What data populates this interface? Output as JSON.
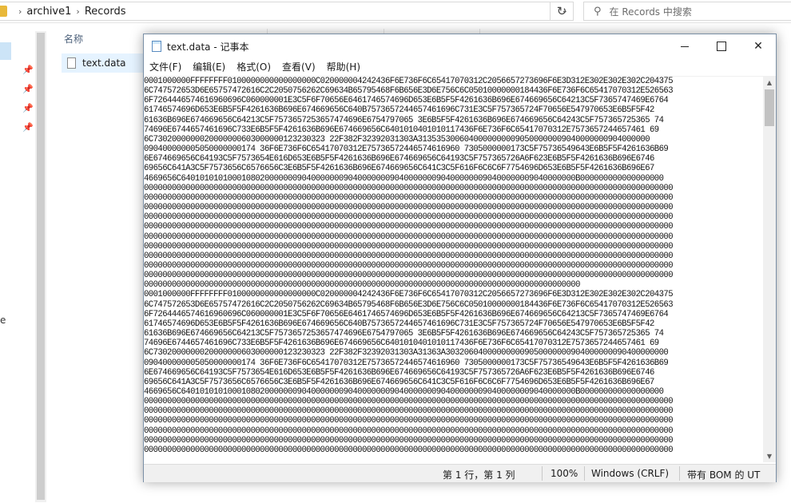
{
  "explorer": {
    "breadcrumbs": [
      "archive1",
      "Records"
    ],
    "search_placeholder": "在 Records 中搜索",
    "column_name": "名称",
    "files": [
      {
        "name": "text.data"
      }
    ],
    "nav_fragment": "e"
  },
  "notepad": {
    "title": "text.data - 记事本",
    "menu": [
      "文件(F)",
      "编辑(E)",
      "格式(O)",
      "查看(V)",
      "帮助(H)"
    ],
    "content_lines": [
      "0001000000FFFFFFFF0100000000000000000C020000004242436F6E736F6C65417070312C2056657273696F6E3D312E302E302E302C204375",
      "6C747572653D6E65757472616C2C2050756262C69634B65795468F6B656E3D6E756C6C05010000000184436F6E736F6C65417070312E526563",
      "6F7264446574616960696C060000001E3C5F6F70656E6461746574696D653E6B5F5F4261636B696E674669656C64213C5F7365747469E6764",
      "61746574696D653E6B5F5F4261636B696E674669656C640B7573657244657461696C731E3C5F757365724F70656E547970653E6B5F5F42",
      "61636B696E674669656C64213C5F7573657253657474696E6754797065 3E6B5F5F4261636B696E674669656C64243C5F757365725365 74",
      "74696E6744657461696C733E6B5F5F4261636B696E674669656C6401010401010117436F6E736F6C65417070312E7573657244657461 69",
      "6C7302000000020000000603000000123230323 22F382F32392031303A31353530060400000000090500000009040000000904000000",
      "090400000005050000000174 36F6E736F6C65417070312E75736572446574616960 7305000000173C5F75736549643E6B5F5F4261636B69",
      "6E674669656C64193C5F7573654E616D653E6B5F5F4261636B696E674669656C64193C5F757365726A6F623E6B5F5F4261636B696E6746",
      "69656C641A3C5F7573656C6576656C3E6B5F5F4261636B696E674669656C641C3C5F616F6C6C6F7754696D653E6B5F5F4261636B696E67",
      "4669656C6401010101000108020000000904000000090400000009040000000904000000090400000009040000000B000000000000000000",
      "000000000000000000000000000000000000000000000000000000000000000000000000000000000000000000000000000000000000000000",
      "000000000000000000000000000000000000000000000000000000000000000000000000000000000000000000000000000000000000000000",
      "000000000000000000000000000000000000000000000000000000000000000000000000000000000000000000000000000000000000000000",
      "000000000000000000000000000000000000000000000000000000000000000000000000000000000000000000000000000000000000000000",
      "000000000000000000000000000000000000000000000000000000000000000000000000000000000000000000000000000000000000000000",
      "000000000000000000000000000000000000000000000000000000000000000000000000000000000000000000000000000000000000000000",
      "000000000000000000000000000000000000000000000000000000000000000000000000000000000000000000000000000000000000000000",
      "000000000000000000000000000000000000000000000000000000000000000000000000000000000000000000000000000000000000000000",
      "000000000000000000000000000000000000000000000000000000000000000000000000000000000000000000000000000000000000000000",
      "000000000000000000000000000000000000000000000000000000000000000000000000000000000000000000000000000000000000000000",
      "0000000000000000000000000000000000000000000000000000000000000000000000000000000000000000000000",
      "0001000000FFFFFFFF0100000000000000000C020000004242436F6E736F6C65417070312C2056657273696F6E3D312E302E302E302C204375",
      "6C747572653D6E65757472616C2C2050756262C69634B65795468F6B656E3D6E756C6C05010000000184436F6E736F6C65417070312E526563",
      "6F7264446574616960696C060000001E3C5F6F70656E6461746574696D653E6B5F5F4261636B696E674669656C64213C5F7365747469E6764",
      "61746574696D653E6B5F5F4261636B696E674669656C640B7573657244657461696C731E3C5F757365724F70656E547970653E6B5F5F42",
      "61636B696E674669656C64213C5F7573657253657474696E6754797065 3E6B5F5F4261636B696E674669656C64243C5F757365725365 74",
      "74696E6744657461696C733E6B5F5F4261636B696E674669656C6401010401010117436F6E736F6C65417070312E7573657244657461 69",
      "6C7302000000020000000603000000123230323 22F382F32392031303A31363A303206040000000009050000000904000000090400000000",
      "090400000005050000000174 36F6E736F6C65417070312E75736572446574616960 7305000000173C5F75736549643E6B5F5F4261636B69",
      "6E674669656C64193C5F7573654E616D653E6B5F5F4261636B696E674669656C64193C5F757365726A6F623E6B5F5F4261636B696E6746",
      "69656C641A3C5F7573656C6576656C3E6B5F5F4261636B696E674669656C641C3C5F616F6C6C6F7754696D653E6B5F5F4261636B696E67",
      "4669656C6401010101000108020000000904000000090400000009040000000904000000090400000009040000000B000000000000000000",
      "000000000000000000000000000000000000000000000000000000000000000000000000000000000000000000000000000000000000000000",
      "000000000000000000000000000000000000000000000000000000000000000000000000000000000000000000000000000000000000000000",
      "000000000000000000000000000000000000000000000000000000000000000000000000000000000000000000000000000000000000000000",
      "000000000000000000000000000000000000000000000000000000000000000000000000000000000000000000000000000000000000000000",
      "000000000000000000000000000000000000000000000000000000000000000000000000000000000000000000000000000000000000000000",
      "000000000000000000000000000000000000000000000000000000000000000000000000000000000000000000000000000000000000000000"
    ],
    "status": {
      "position": "第 1 行，第 1 列",
      "zoom": "100%",
      "line_ending": "Windows (CRLF)",
      "encoding": "带有 BOM 的 UT"
    }
  }
}
